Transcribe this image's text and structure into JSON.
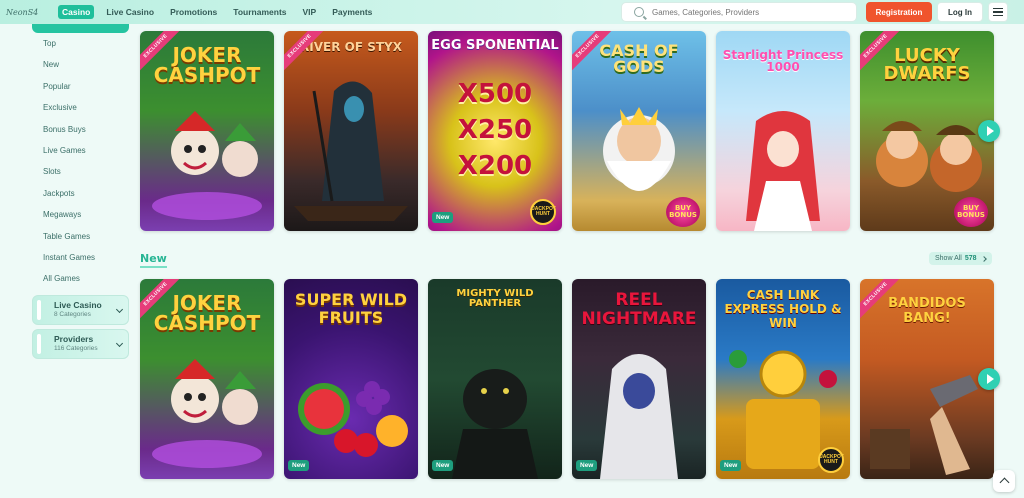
{
  "header": {
    "logo": "NeonS4",
    "nav": [
      "Casino",
      "Live Casino",
      "Promotions",
      "Tournaments",
      "VIP",
      "Payments"
    ],
    "active_nav": "Casino",
    "search_placeholder": "Games, Categories, Providers",
    "register_label": "Registration",
    "login_label": "Log In"
  },
  "sidebar": {
    "categories": [
      "Top",
      "New",
      "Popular",
      "Exclusive",
      "Bonus Buys",
      "Live Games",
      "Slots",
      "Jackpots",
      "Megaways",
      "Table Games",
      "Instant Games",
      "All Games"
    ],
    "groups": [
      {
        "title": "Live Casino",
        "sub": "8 Categories"
      },
      {
        "title": "Providers",
        "sub": "116 Categories"
      }
    ]
  },
  "sections": {
    "new_title": "New",
    "show_all_label": "Show All",
    "show_all_count": "578"
  },
  "badges": {
    "exclusive": "EXCLUSIVE",
    "new": "New",
    "buy_bonus": "BUY BONUS",
    "jackpot_hunt": "JACKPOT HUNT"
  },
  "row1": [
    {
      "title": "JOKER CASHPOT",
      "exclusive": true
    },
    {
      "title": "RIVER OF STYX",
      "exclusive": true
    },
    {
      "title": "EGG SPONENTIAL",
      "multipliers": [
        "X500",
        "X250",
        "X200"
      ],
      "new": true,
      "jackpot": true
    },
    {
      "title": "CASH OF GODS",
      "exclusive": true,
      "buy_bonus": true
    },
    {
      "title": "Starlight Princess 1000"
    },
    {
      "title": "LUCKY DWARFS",
      "exclusive": true,
      "buy_bonus": true
    }
  ],
  "row2": [
    {
      "title": "JOKER CASHPOT",
      "exclusive": true
    },
    {
      "title": "SUPER WILD FRUITS",
      "new": true
    },
    {
      "title": "MIGHTY WILD PANTHER",
      "new": true
    },
    {
      "title": "REEL NIGHTMARE",
      "new": true
    },
    {
      "title": "CASH LINK EXPRESS HOLD & WIN",
      "new": true,
      "jackpot": true
    },
    {
      "title": "BANDIDOS BANG!",
      "exclusive": true
    }
  ]
}
